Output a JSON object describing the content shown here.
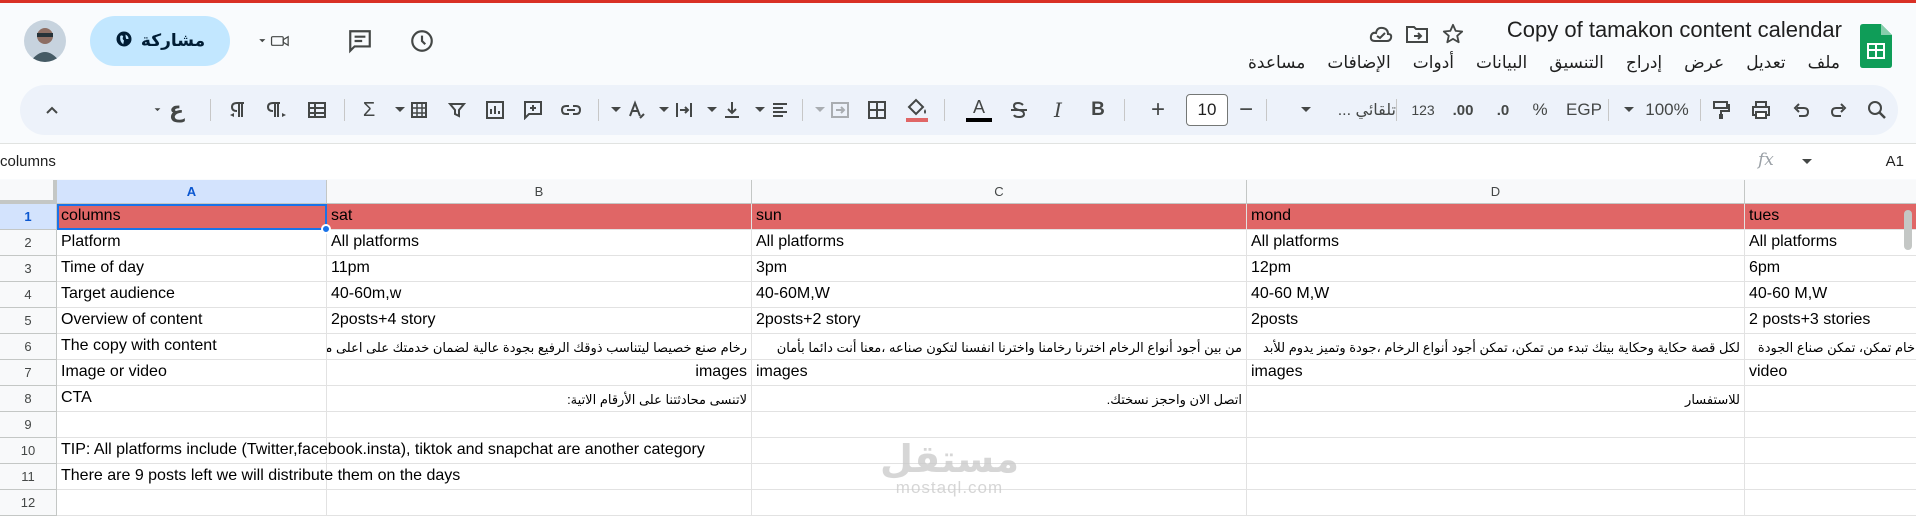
{
  "app": {
    "doc_title": "Copy of tamakon content calendar",
    "menu": [
      "ملف",
      "تعديل",
      "عرض",
      "إدراج",
      "التنسيق",
      "البيانات",
      "أدوات",
      "الإضافات",
      "مساعدة"
    ],
    "share_label": "مشاركة",
    "accent_color": "#0b57d0",
    "share_bg": "#c2e7ff"
  },
  "toolbar": {
    "zoom": "100%",
    "currency": "EGP",
    "percent": "%",
    "dec_decrease": ".0",
    "dec_increase": ".00",
    "number_format": "123",
    "font_name": "تلقائي ...",
    "font_size": "10",
    "minus": "−",
    "plus": "+",
    "bold": "B",
    "italic": "I",
    "text_color": "A",
    "sum": "Σ",
    "arabic_char": "ع"
  },
  "formula_bar": {
    "cell_ref": "A1",
    "content": "columns",
    "fx": "fx"
  },
  "sheet": {
    "columns": [
      "A",
      "B",
      "C",
      "D",
      ""
    ],
    "rows": [
      "1",
      "2",
      "3",
      "4",
      "5",
      "6",
      "7",
      "8",
      "9",
      "10",
      "11",
      "12"
    ],
    "header_row": [
      "columns",
      "sat",
      "sun",
      "mond",
      "tues"
    ],
    "header_color": "#e06666",
    "data": [
      [
        "Platform",
        "All platforms",
        "All platforms",
        "All platforms",
        "All platforms"
      ],
      [
        "Time of day",
        "11pm",
        "3pm",
        "12pm",
        "6pm"
      ],
      [
        "Target audience",
        "40-60m,w",
        "40-60M,W",
        "40-60 M,W",
        "40-60 M,W"
      ],
      [
        "Overview of content",
        "2posts+4 story",
        "2posts+2 story",
        "2posts",
        "2 posts+3 stories"
      ],
      [
        "The copy with content",
        "رخام صنع خصيصا ليتناسب ذوقك الرفيع بجودة عالية لضمان خدمتك على اعلى مستوى",
        "من بين أجود أنواع الرخام اخترنا رخامنا واخترنا انفسنا لتكون صناعه ،معنا أنت دائما بأمان",
        "لكل قصة حكاية وحكاية بيتك تبدء من تمكن، تمكن أجود أنواع الرخام ،جودة وتميز يدوم للأبد",
        "خام تمكن، تمكن صناع الجودة"
      ],
      [
        "Image or video",
        "images",
        "images",
        "images",
        "video"
      ],
      [
        "CTA",
        "لاتنسى محادثتنا على الأرقام الاتية:",
        "اتصل الان واحجز نسختك.",
        "للاستفسار",
        ""
      ]
    ],
    "tip": "TIP: All platforms include (Twitter,facebook.insta), tiktok and snapchat are another  category",
    "note": "There are 9 posts left we will distribute them on the days"
  },
  "watermark": {
    "arabic": "مستقل",
    "latin": "mostaql.com"
  }
}
